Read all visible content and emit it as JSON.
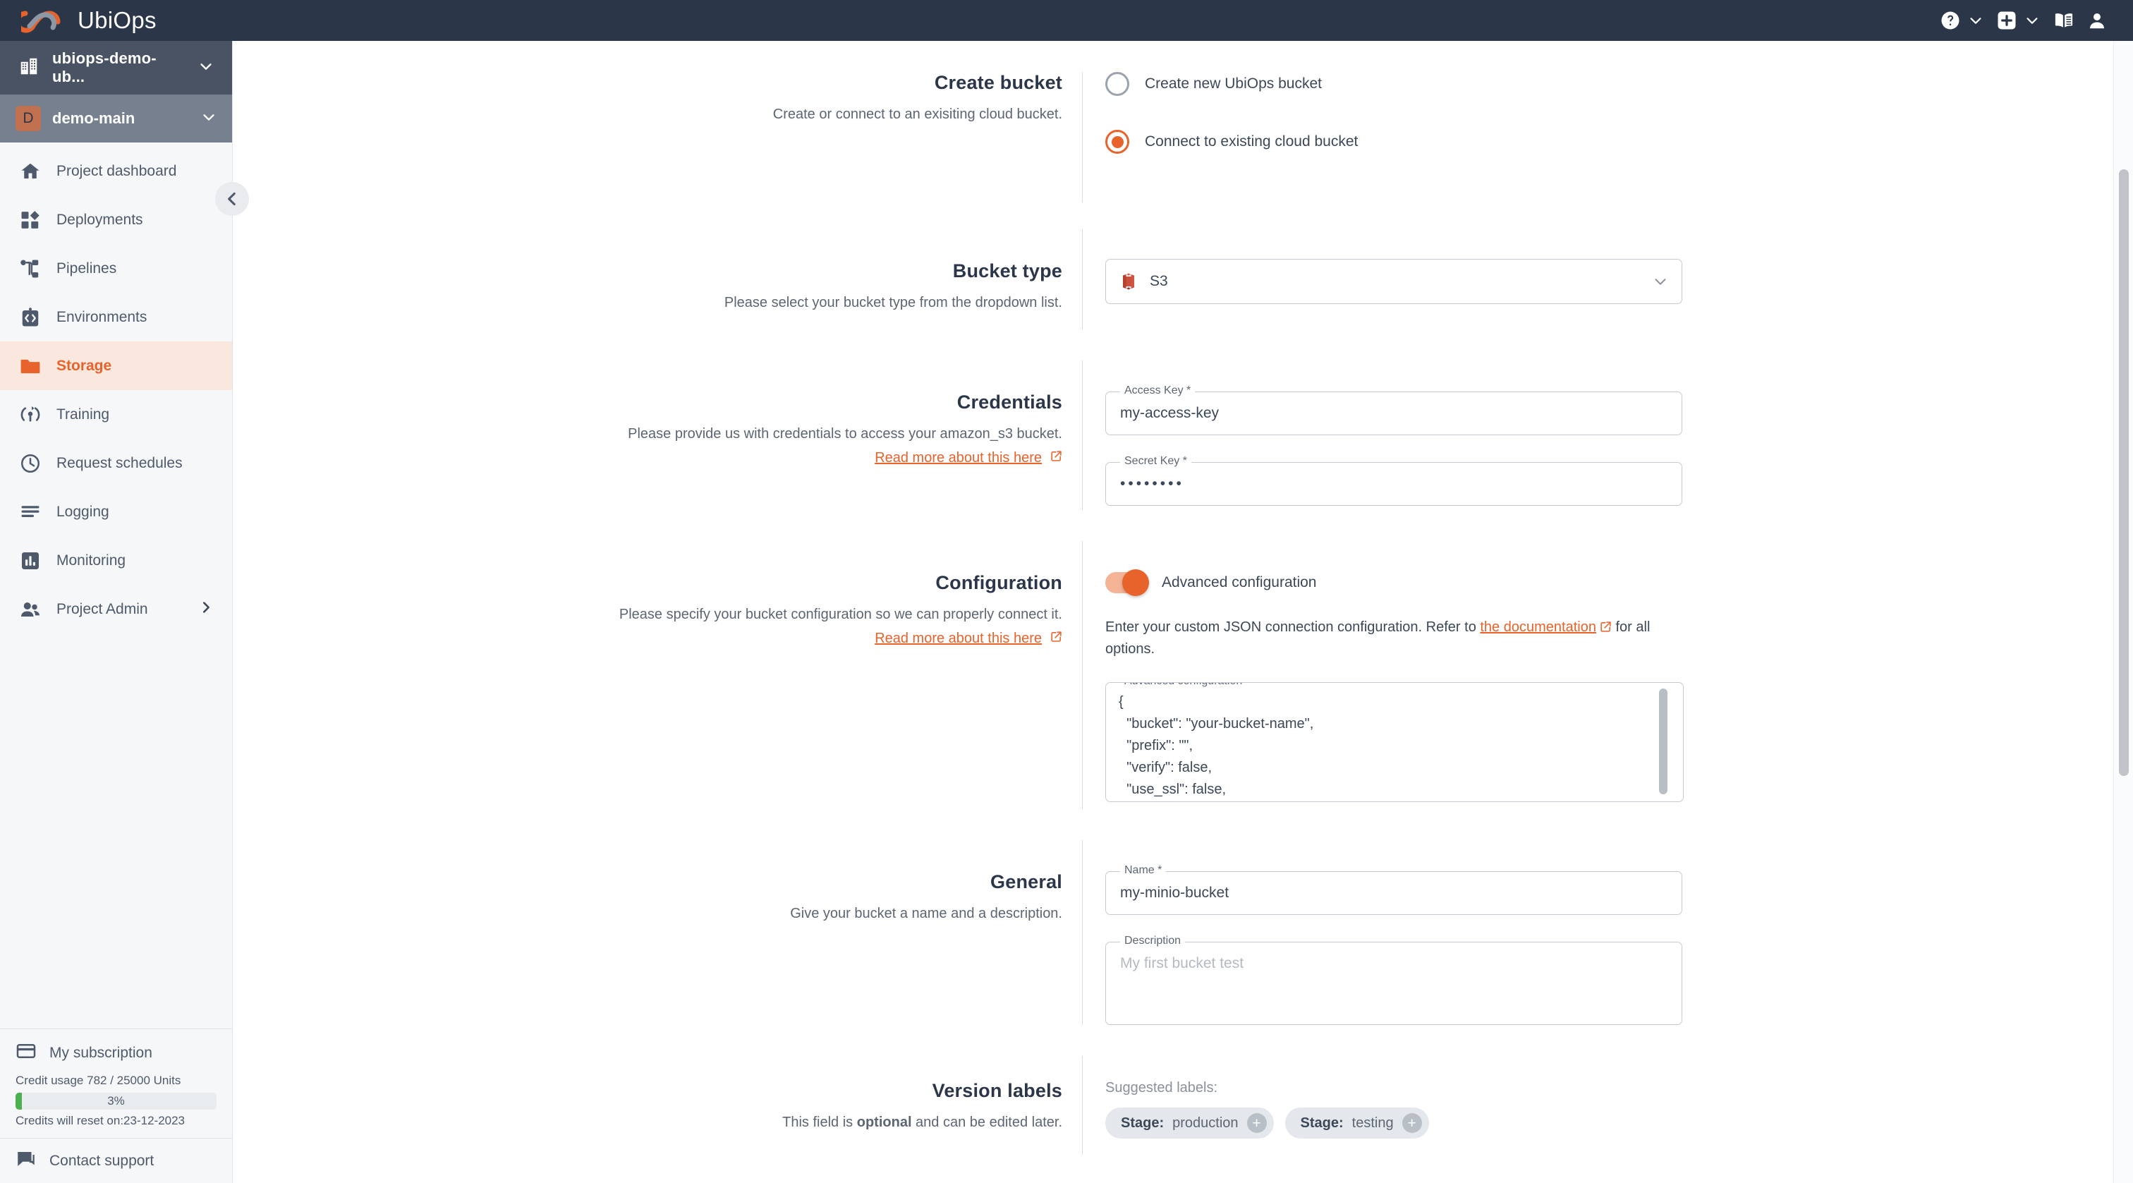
{
  "topbar": {
    "brand": "UbiOps",
    "icons": [
      {
        "name": "help-icon",
        "glyph": "?"
      },
      {
        "name": "help-chevron-down-icon",
        "glyph": "v"
      },
      {
        "name": "create-new-icon",
        "glyph": "+"
      },
      {
        "name": "create-chevron-down-icon",
        "glyph": "v"
      },
      {
        "name": "docs-book-icon",
        "glyph": "book"
      },
      {
        "name": "user-account-icon",
        "glyph": "person"
      }
    ]
  },
  "sidebar": {
    "organization": "ubiops-demo-ub...",
    "project": "demo-main",
    "project_initial": "D",
    "items": [
      {
        "label": "Project dashboard",
        "icon": "home-icon",
        "active": false
      },
      {
        "label": "Deployments",
        "icon": "deployments-icon",
        "active": false
      },
      {
        "label": "Pipelines",
        "icon": "pipelines-icon",
        "active": false
      },
      {
        "label": "Environments",
        "icon": "environments-icon",
        "active": false
      },
      {
        "label": "Storage",
        "icon": "folder-icon",
        "active": true
      },
      {
        "label": "Training",
        "icon": "training-icon",
        "active": false
      },
      {
        "label": "Request schedules",
        "icon": "clock-icon",
        "active": false
      },
      {
        "label": "Logging",
        "icon": "logging-icon",
        "active": false
      },
      {
        "label": "Monitoring",
        "icon": "monitoring-icon",
        "active": false
      },
      {
        "label": "Project Admin",
        "icon": "users-icon",
        "active": false,
        "has_submenu": true
      }
    ],
    "subscription": {
      "label": "My subscription",
      "credit_usage": "Credit usage 782 / 25000 Units",
      "percent_label": "3%",
      "percent_value": 3,
      "reset": "Credits will reset on:23-12-2023",
      "bar_color": "#4caf50"
    },
    "support": "Contact support"
  },
  "form": {
    "create_bucket": {
      "title": "Create bucket",
      "description": "Create or connect to an exisiting cloud bucket.",
      "options": [
        {
          "label": "Create new UbiOps bucket",
          "selected": false
        },
        {
          "label": "Connect to existing cloud bucket",
          "selected": true
        }
      ]
    },
    "bucket_type": {
      "title": "Bucket type",
      "description": "Please select your bucket type from the dropdown list.",
      "selected": "S3",
      "icon": "amazon-s3-icon"
    },
    "credentials": {
      "title": "Credentials",
      "description": "Please provide us with credentials to access your amazon_s3 bucket.",
      "link": "Read more about this here",
      "access_key_label": "Access Key *",
      "access_key_value": "my-access-key",
      "secret_key_label": "Secret Key *",
      "secret_key_value": "••••••••"
    },
    "configuration": {
      "title": "Configuration",
      "description": "Please specify your bucket configuration so we can properly connect it.",
      "link": "Read more about this here",
      "toggle_label": "Advanced configuration",
      "toggle_on": true,
      "helper_prefix": "Enter your custom JSON connection configuration. Refer to ",
      "helper_link": "the documentation",
      "helper_suffix": " for all options.",
      "textarea_label": "Advanced configuration",
      "textarea_value": "{\n  \"bucket\": \"your-bucket-name\",\n  \"prefix\": \"\",\n  \"verify\": false,\n  \"use_ssl\": false,\n  \"endpoint_url\": \"https://minio.mydomain.com:port\",\n  \"signature_version\": \"XXXX\",\n  \"region\": null"
    },
    "general": {
      "title": "General",
      "description": "Give your bucket a name and a description.",
      "name_label": "Name *",
      "name_value": "my-minio-bucket",
      "description_label": "Description",
      "description_placeholder": "My first bucket test"
    },
    "version_labels": {
      "title": "Version labels",
      "description_prefix": "This field is ",
      "description_bold": "optional",
      "description_suffix": " and can be edited later.",
      "suggested_title": "Suggested labels:",
      "chips": [
        {
          "key": "Stage:",
          "value": "production"
        },
        {
          "key": "Stage:",
          "value": "testing"
        }
      ]
    }
  },
  "colors": {
    "accent": "#e8622b",
    "topbar_bg": "#2b3648",
    "sidebar_bg": "#f6f7f9",
    "active_bg": "#fae7dd",
    "credit_green": "#4caf50"
  }
}
